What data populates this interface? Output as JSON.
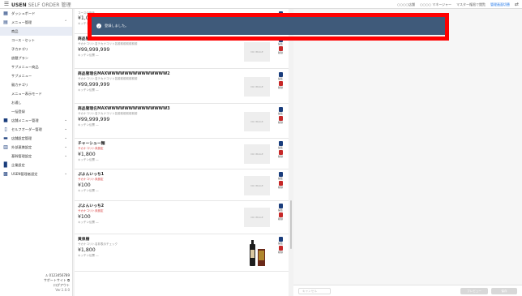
{
  "header": {
    "brand_bold": "USEN",
    "brand_rest": " SELF ORDER 管理",
    "store_hint": "○○○○店舗",
    "user_hint": "○○○○ マネージャー",
    "account_hint": "マスター権限で閲覧",
    "account_link": "管理画面切替"
  },
  "sidebar": {
    "items": [
      {
        "label": "ダッシュボード",
        "icon": "grid-icon"
      },
      {
        "label": "メニュー管理",
        "icon": "book-icon",
        "expanded": true
      }
    ],
    "sub_items": [
      "商品",
      "コース・セット",
      "子カテゴリ",
      "放題プラン",
      "サブメニュー商品",
      "サブメニュー",
      "親カテゴリ",
      "メニュー表示モード",
      "お通し",
      "一括登録"
    ],
    "groups": [
      {
        "label": "店舗メニュー管理",
        "icon": "store-icon"
      },
      {
        "label": "セルフオーダー管理",
        "icon": "tablet-icon"
      },
      {
        "label": "店舗設定管理",
        "icon": "settings-icon"
      },
      {
        "label": "外部連携設定",
        "icon": "link-icon"
      },
      {
        "label": "基幹管理設定",
        "icon": "server-icon"
      },
      {
        "label": "企業設定",
        "icon": "building-icon"
      },
      {
        "label": "USEN管理者設定",
        "icon": "admin-icon"
      }
    ],
    "footer": {
      "account": "0123456789",
      "support": "サポートサイト",
      "logout": "ログアウト",
      "version": "Ver.1.0.0"
    }
  },
  "list": {
    "items": [
      {
        "name": "コースの商品",
        "desc": "",
        "price": "¥1,0",
        "kitchen": "キッチン伝票 ―",
        "thumb": ""
      },
      {
        "name": "商品管理名MAXWWWWWWWWWWWWWW",
        "desc": "サカナコリト名テカナコリト名前前前前前前前",
        "price": "¥99,999,999",
        "kitchen": "キッチン伝票 ―",
        "thumb": "NO IMAGE"
      },
      {
        "name": "商品管理名MAXWWWWWWWWWWWWWW2",
        "desc": "サカナコリト名テカナコリト名前前前前前前前",
        "price": "¥99,999,999",
        "kitchen": "キッチン伝票 ―",
        "thumb": "NO IMAGE"
      },
      {
        "name": "商品管理名MAXWWWWWWWWWWWWWW3",
        "desc": "サカナコリト名テカナコリト名前前前前前前前",
        "price": "¥99,999,999",
        "kitchen": "キッチン伝票 ―",
        "thumb": "NO IMAGE"
      },
      {
        "name": "チャーシュー麺",
        "desc": "サカナコリト未設定",
        "desc_red": true,
        "price": "¥1,800",
        "kitchen": "キッチン伝票 ―",
        "thumb": "NO IMAGE"
      },
      {
        "name": "ぷよんいっち1",
        "desc": "サカナコリト未設定",
        "desc_red": true,
        "price": "¥100",
        "kitchen": "キッチン伝票 ―",
        "thumb": "NO IMAGE"
      },
      {
        "name": "ぷよんいっち2",
        "desc": "サカナコリト未設定",
        "desc_red": true,
        "price": "¥100",
        "kitchen": "キッチン伝票 ―",
        "thumb": "NO IMAGE"
      },
      {
        "name": "黄泉樹",
        "desc": "サカナコリト名非表示チェック",
        "price": "¥1,800",
        "kitchen": "キッチン伝票 ―",
        "thumb": "bottle"
      }
    ],
    "edit_label": "編集",
    "delete_label": "削除"
  },
  "detail": {
    "cancel_label": "キャンセル",
    "preview_label": "プレビュー",
    "save_label": "保存"
  },
  "toast": {
    "message": "登録しました。"
  }
}
